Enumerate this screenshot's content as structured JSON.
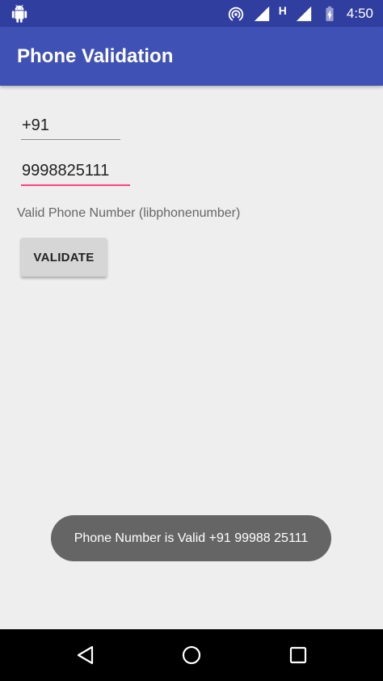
{
  "status_bar": {
    "time": "4:50",
    "network_type": "H",
    "icons": [
      "android-icon",
      "hotspot-icon",
      "signal-icon",
      "signal-icon",
      "battery-charging-icon"
    ]
  },
  "app_bar": {
    "title": "Phone Validation"
  },
  "form": {
    "country_code_value": "+91",
    "phone_number_value": "9998825111",
    "result_label": "Valid Phone Number (libphonenumber)",
    "validate_label": "VALIDATE"
  },
  "toast": {
    "message": "Phone Number is Valid +91 99988 25111"
  },
  "nav_bar": {
    "icons": [
      "back-icon",
      "home-icon",
      "recents-icon"
    ]
  },
  "colors": {
    "status_bar": "#303f9f",
    "app_bar": "#3f51b5",
    "accent": "#ff4081",
    "background": "#eeeeee",
    "toast": "#656565"
  }
}
